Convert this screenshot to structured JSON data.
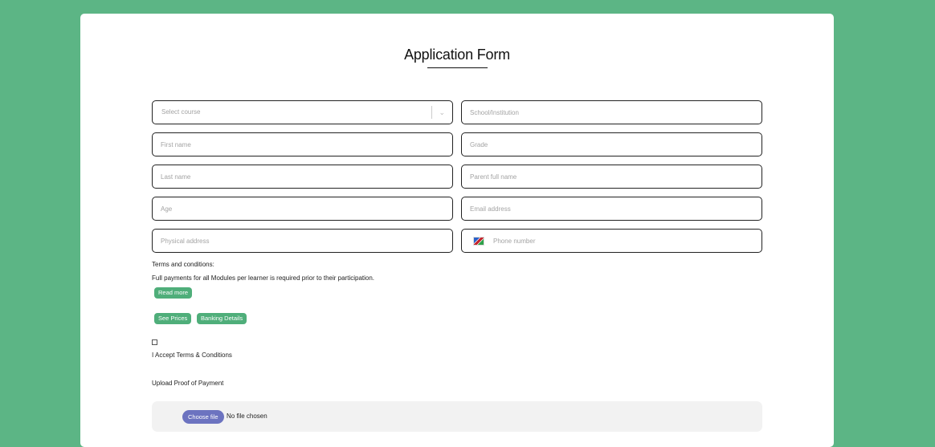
{
  "form": {
    "title": "Application Form",
    "fields": {
      "course_placeholder": "Select course",
      "school_placeholder": "School/Institution",
      "first_name_placeholder": "First name",
      "grade_placeholder": "Grade",
      "last_name_placeholder": "Last name",
      "parent_placeholder": "Parent full name",
      "age_placeholder": "Age",
      "email_placeholder": "Email address",
      "address_placeholder": "Physical address",
      "phone_placeholder": "Phone number"
    },
    "terms": {
      "heading": "Terms and conditions:",
      "text": "Full payments for all Modules per learner is required prior to their participation.",
      "read_more": "Read more",
      "see_prices": "See Prices",
      "banking_details": "Banking Details",
      "accept_label": "I Accept Terms & Conditions"
    },
    "upload": {
      "label": "Upload Proof of Payment",
      "button": "Choose file",
      "status": "No file chosen"
    }
  },
  "colors": {
    "background": "#5cb585",
    "button_green": "#4fae7a",
    "file_button": "#6c73c0"
  },
  "icons": {
    "dropdown": "chevron-down-icon",
    "flag": "namibia-flag-icon"
  }
}
